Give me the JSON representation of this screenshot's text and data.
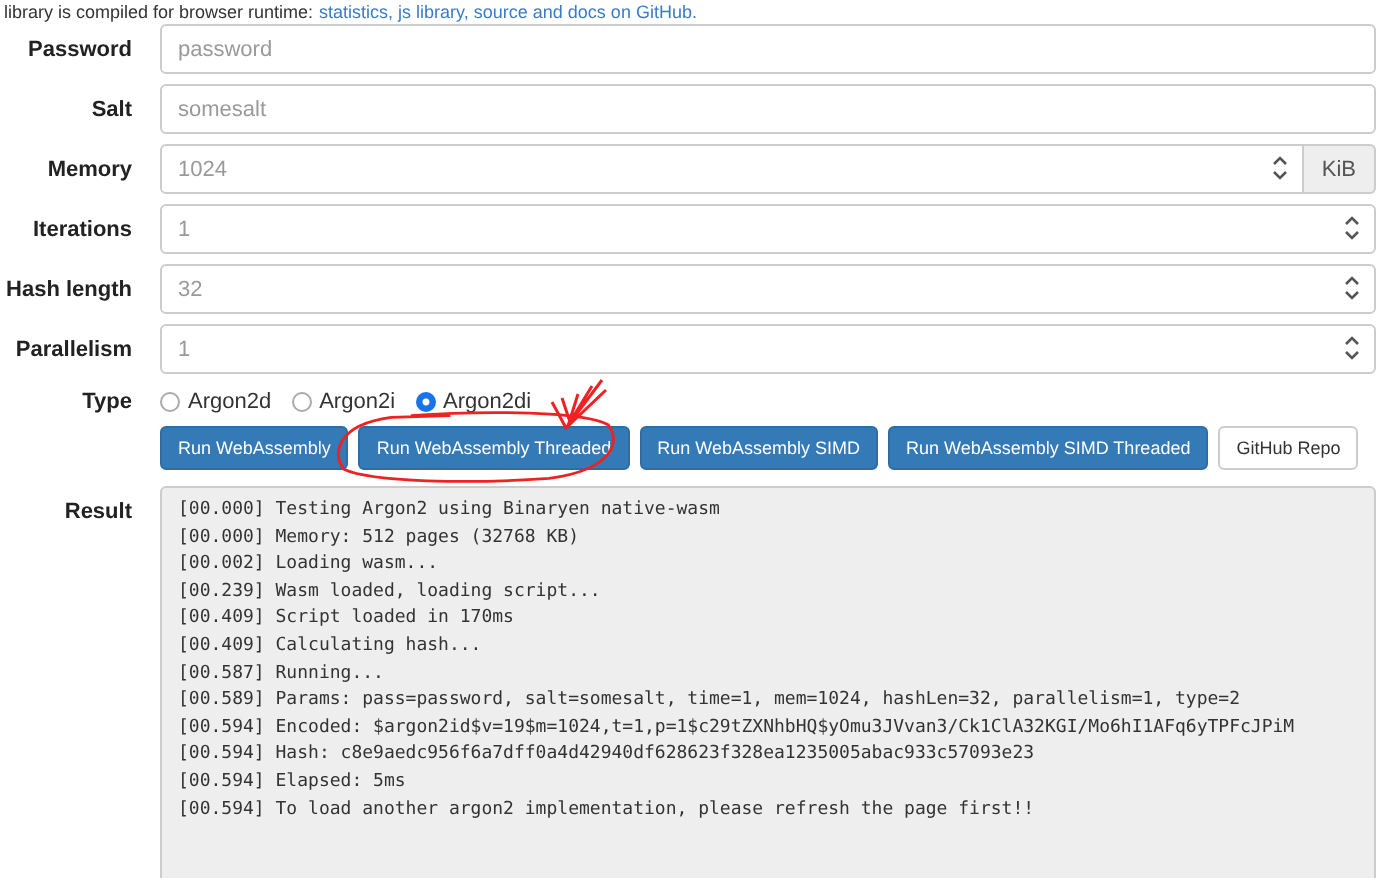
{
  "intro": {
    "text": "library is compiled for browser runtime:",
    "link": "statistics, js library, source and docs on GitHub."
  },
  "fields": [
    {
      "label": "Password",
      "kind": "text",
      "placeholder": "password"
    },
    {
      "label": "Salt",
      "kind": "text",
      "placeholder": "somesalt"
    },
    {
      "label": "Memory",
      "kind": "number",
      "placeholder": "1024",
      "addon": "KiB"
    },
    {
      "label": "Iterations",
      "kind": "number",
      "placeholder": "1"
    },
    {
      "label": "Hash length",
      "kind": "number",
      "placeholder": "32"
    },
    {
      "label": "Parallelism",
      "kind": "number",
      "placeholder": "1"
    }
  ],
  "type": {
    "label": "Type",
    "options": [
      {
        "label": "Argon2d",
        "selected": false
      },
      {
        "label": "Argon2i",
        "selected": false
      },
      {
        "label": "Argon2di",
        "selected": true
      }
    ]
  },
  "buttons": [
    {
      "label": "Run WebAssembly",
      "kind": "primary"
    },
    {
      "label": "Run WebAssembly Threaded",
      "kind": "primary"
    },
    {
      "label": "Run WebAssembly SIMD",
      "kind": "primary"
    },
    {
      "label": "Run WebAssembly SIMD Threaded",
      "kind": "primary"
    },
    {
      "label": "GitHub Repo",
      "kind": "default"
    }
  ],
  "result": {
    "label": "Result",
    "lines": [
      "[00.000] Testing Argon2 using Binaryen native-wasm",
      "[00.000] Memory: 512 pages (32768 KB)",
      "[00.002] Loading wasm...",
      "[00.239] Wasm loaded, loading script...",
      "[00.409] Script loaded in 170ms",
      "[00.409] Calculating hash...",
      "[00.587] Running...",
      "[00.589] Params: pass=password, salt=somesalt, time=1, mem=1024, hashLen=32, parallelism=1, type=2",
      "[00.594] Encoded: $argon2id$v=19$m=1024,t=1,p=1$c29tZXNhbHQ$yOmu3JVvan3/Ck1ClA32KGI/Mo6hI1AFq6yTPFcJPiM",
      "[00.594] Hash: c8e9aedc956f6a7dff0a4d42940df628623f328ea1235005abac933c57093e23",
      "[00.594] Elapsed: 5ms",
      "[00.594] To load another argon2 implementation, please refresh the page first!!"
    ]
  }
}
